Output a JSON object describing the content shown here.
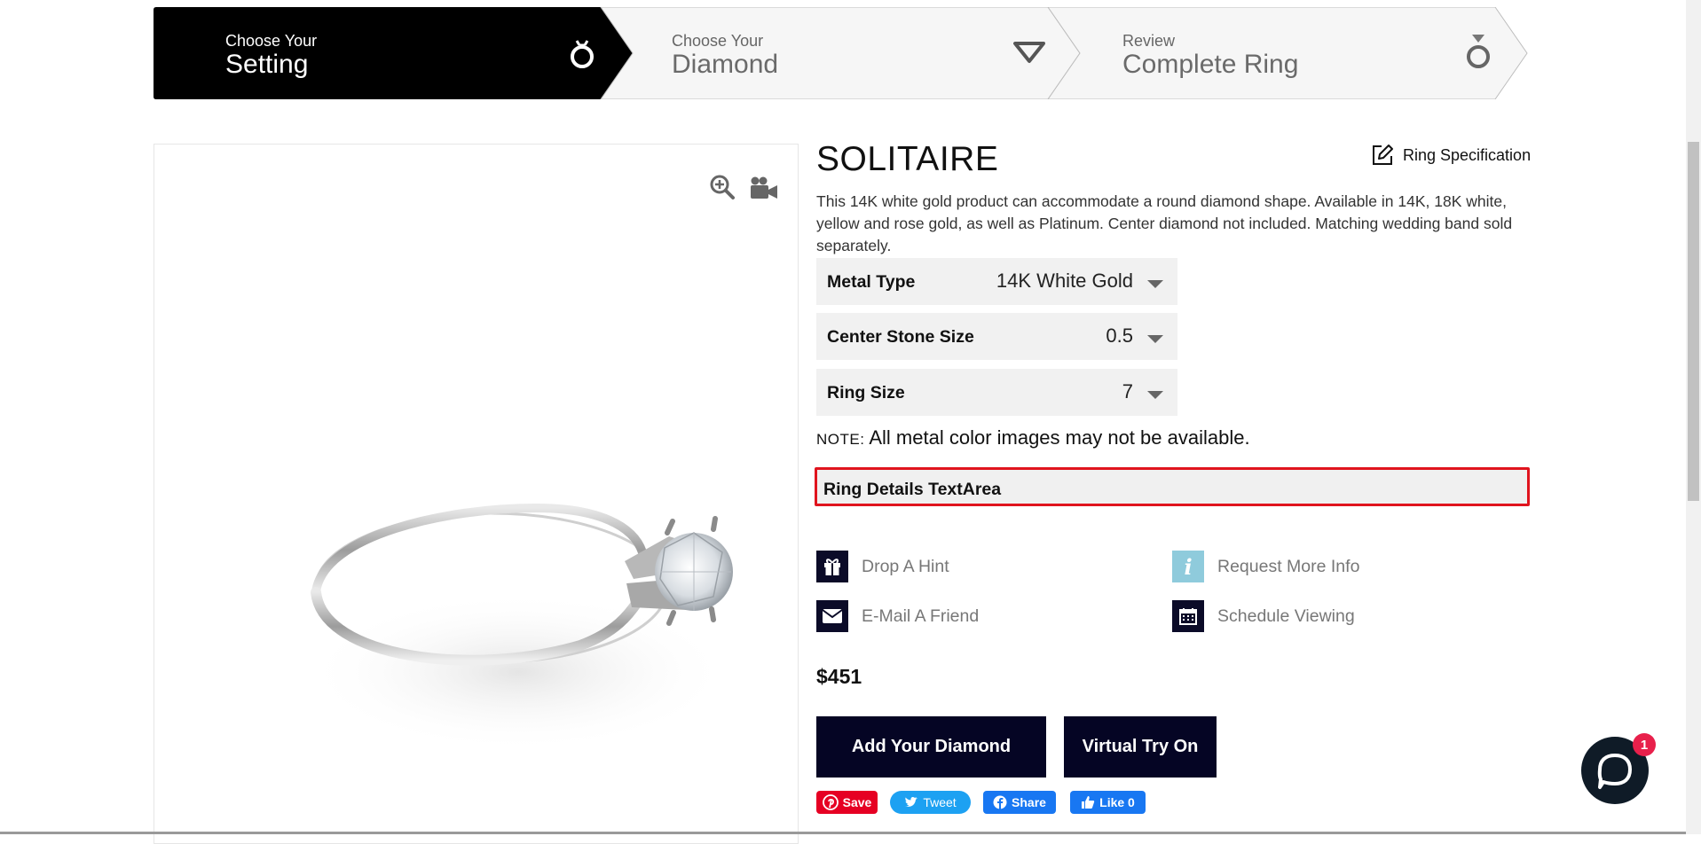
{
  "steps": [
    {
      "sub": "Choose Your",
      "main": "Setting",
      "icon": "ring-icon",
      "active": true
    },
    {
      "sub": "Choose Your",
      "main": "Diamond",
      "icon": "diamond-icon",
      "active": false
    },
    {
      "sub": "Review",
      "main": "Complete Ring",
      "icon": "diamond-ring-icon",
      "active": false
    }
  ],
  "image_tools": {
    "zoom_icon": "zoom-in-icon",
    "video_icon": "video-camera-icon"
  },
  "product": {
    "title": "SOLITAIRE",
    "spec_link": "Ring Specification",
    "description": "This 14K white gold product can accommodate a round diamond shape. Available in 14K, 18K white, yellow and rose gold, as well as Platinum. Center diamond not included. Matching wedding band sold separately."
  },
  "options": [
    {
      "label": "Metal Type",
      "value": "14K White Gold"
    },
    {
      "label": "Center Stone Size",
      "value": "0.5"
    },
    {
      "label": "Ring Size",
      "value": "7"
    }
  ],
  "note": {
    "label": "NOTE:",
    "text": "All metal color images may not be available."
  },
  "ring_details": {
    "label": "Ring Details TextArea"
  },
  "actions": {
    "drop_hint": "Drop A Hint",
    "request_info": "Request More Info",
    "email_friend": "E-Mail A Friend",
    "schedule_viewing": "Schedule Viewing"
  },
  "price": "$451",
  "buttons": {
    "add_diamond": "Add Your Diamond",
    "virtual_try_on": "Virtual Try On"
  },
  "social": {
    "save": "Save",
    "tweet": "Tweet",
    "share": "Share",
    "like": "Like 0"
  },
  "chat": {
    "badge": "1"
  },
  "colors": {
    "accent_dark": "#050524",
    "highlight_border": "#e0141e",
    "pinterest": "#e60023",
    "twitter": "#1da1f2",
    "facebook": "#1877f2"
  }
}
